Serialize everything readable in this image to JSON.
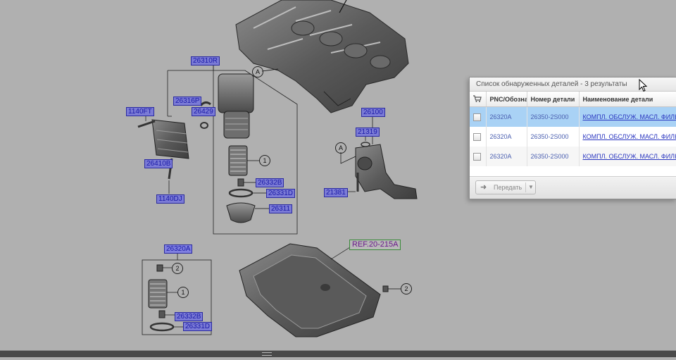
{
  "diagram": {
    "callouts": {
      "c26310R": "26310R",
      "c26316P": "26316P",
      "c26429": "26429",
      "c1140FT": "1140FT",
      "c26410B": "26410B",
      "c1140DJ": "1140DJ",
      "c26332B_top": "26332B",
      "c26331D_top": "26331D",
      "c26311": "26311",
      "c26100": "26100",
      "c21319": "21319",
      "c21381": "21381",
      "c26320A": "26320A",
      "c26332B_bot": "26332B",
      "c26331D_bot": "26331D",
      "ref": "REF.20-215A"
    },
    "markers": {
      "A1": "A",
      "A2": "A",
      "n1_top": "1",
      "n1_bot": "1",
      "n2_left": "2",
      "n2_right": "2"
    }
  },
  "panel": {
    "title": "Список обнаруженных деталей - 3 результаты",
    "columns": [
      "",
      "PNC/Обозна",
      "Номер детали",
      "Наименование детали"
    ],
    "rows": [
      {
        "pnc": "26320A",
        "part_no": "26350-2S000",
        "name": "КОМПЛ. ОБСЛУЖ. МАСЛ. ФИЛЬТ",
        "selected": true
      },
      {
        "pnc": "26320A",
        "part_no": "26350-2S000",
        "name": "КОМПЛ. ОБСЛУЖ. МАСЛ. ФИЛЬТ",
        "selected": false
      },
      {
        "pnc": "26320A",
        "part_no": "26350-2S000",
        "name": "КОМПЛ. ОБСЛУЖ. МАСЛ. ФИЛЬТ",
        "selected": false
      }
    ],
    "send_button": "Передать"
  },
  "icons": {
    "cart": "cart-icon",
    "send": "forward-arrow-icon",
    "dropdown": "chevron-down-icon",
    "cursor": "mouse-cursor-icon"
  },
  "colors": {
    "background": "#b0b0b0",
    "callout_fill": "#7b7bd6",
    "selected_row": "#a9d2f5",
    "link": "#2a36c0"
  }
}
